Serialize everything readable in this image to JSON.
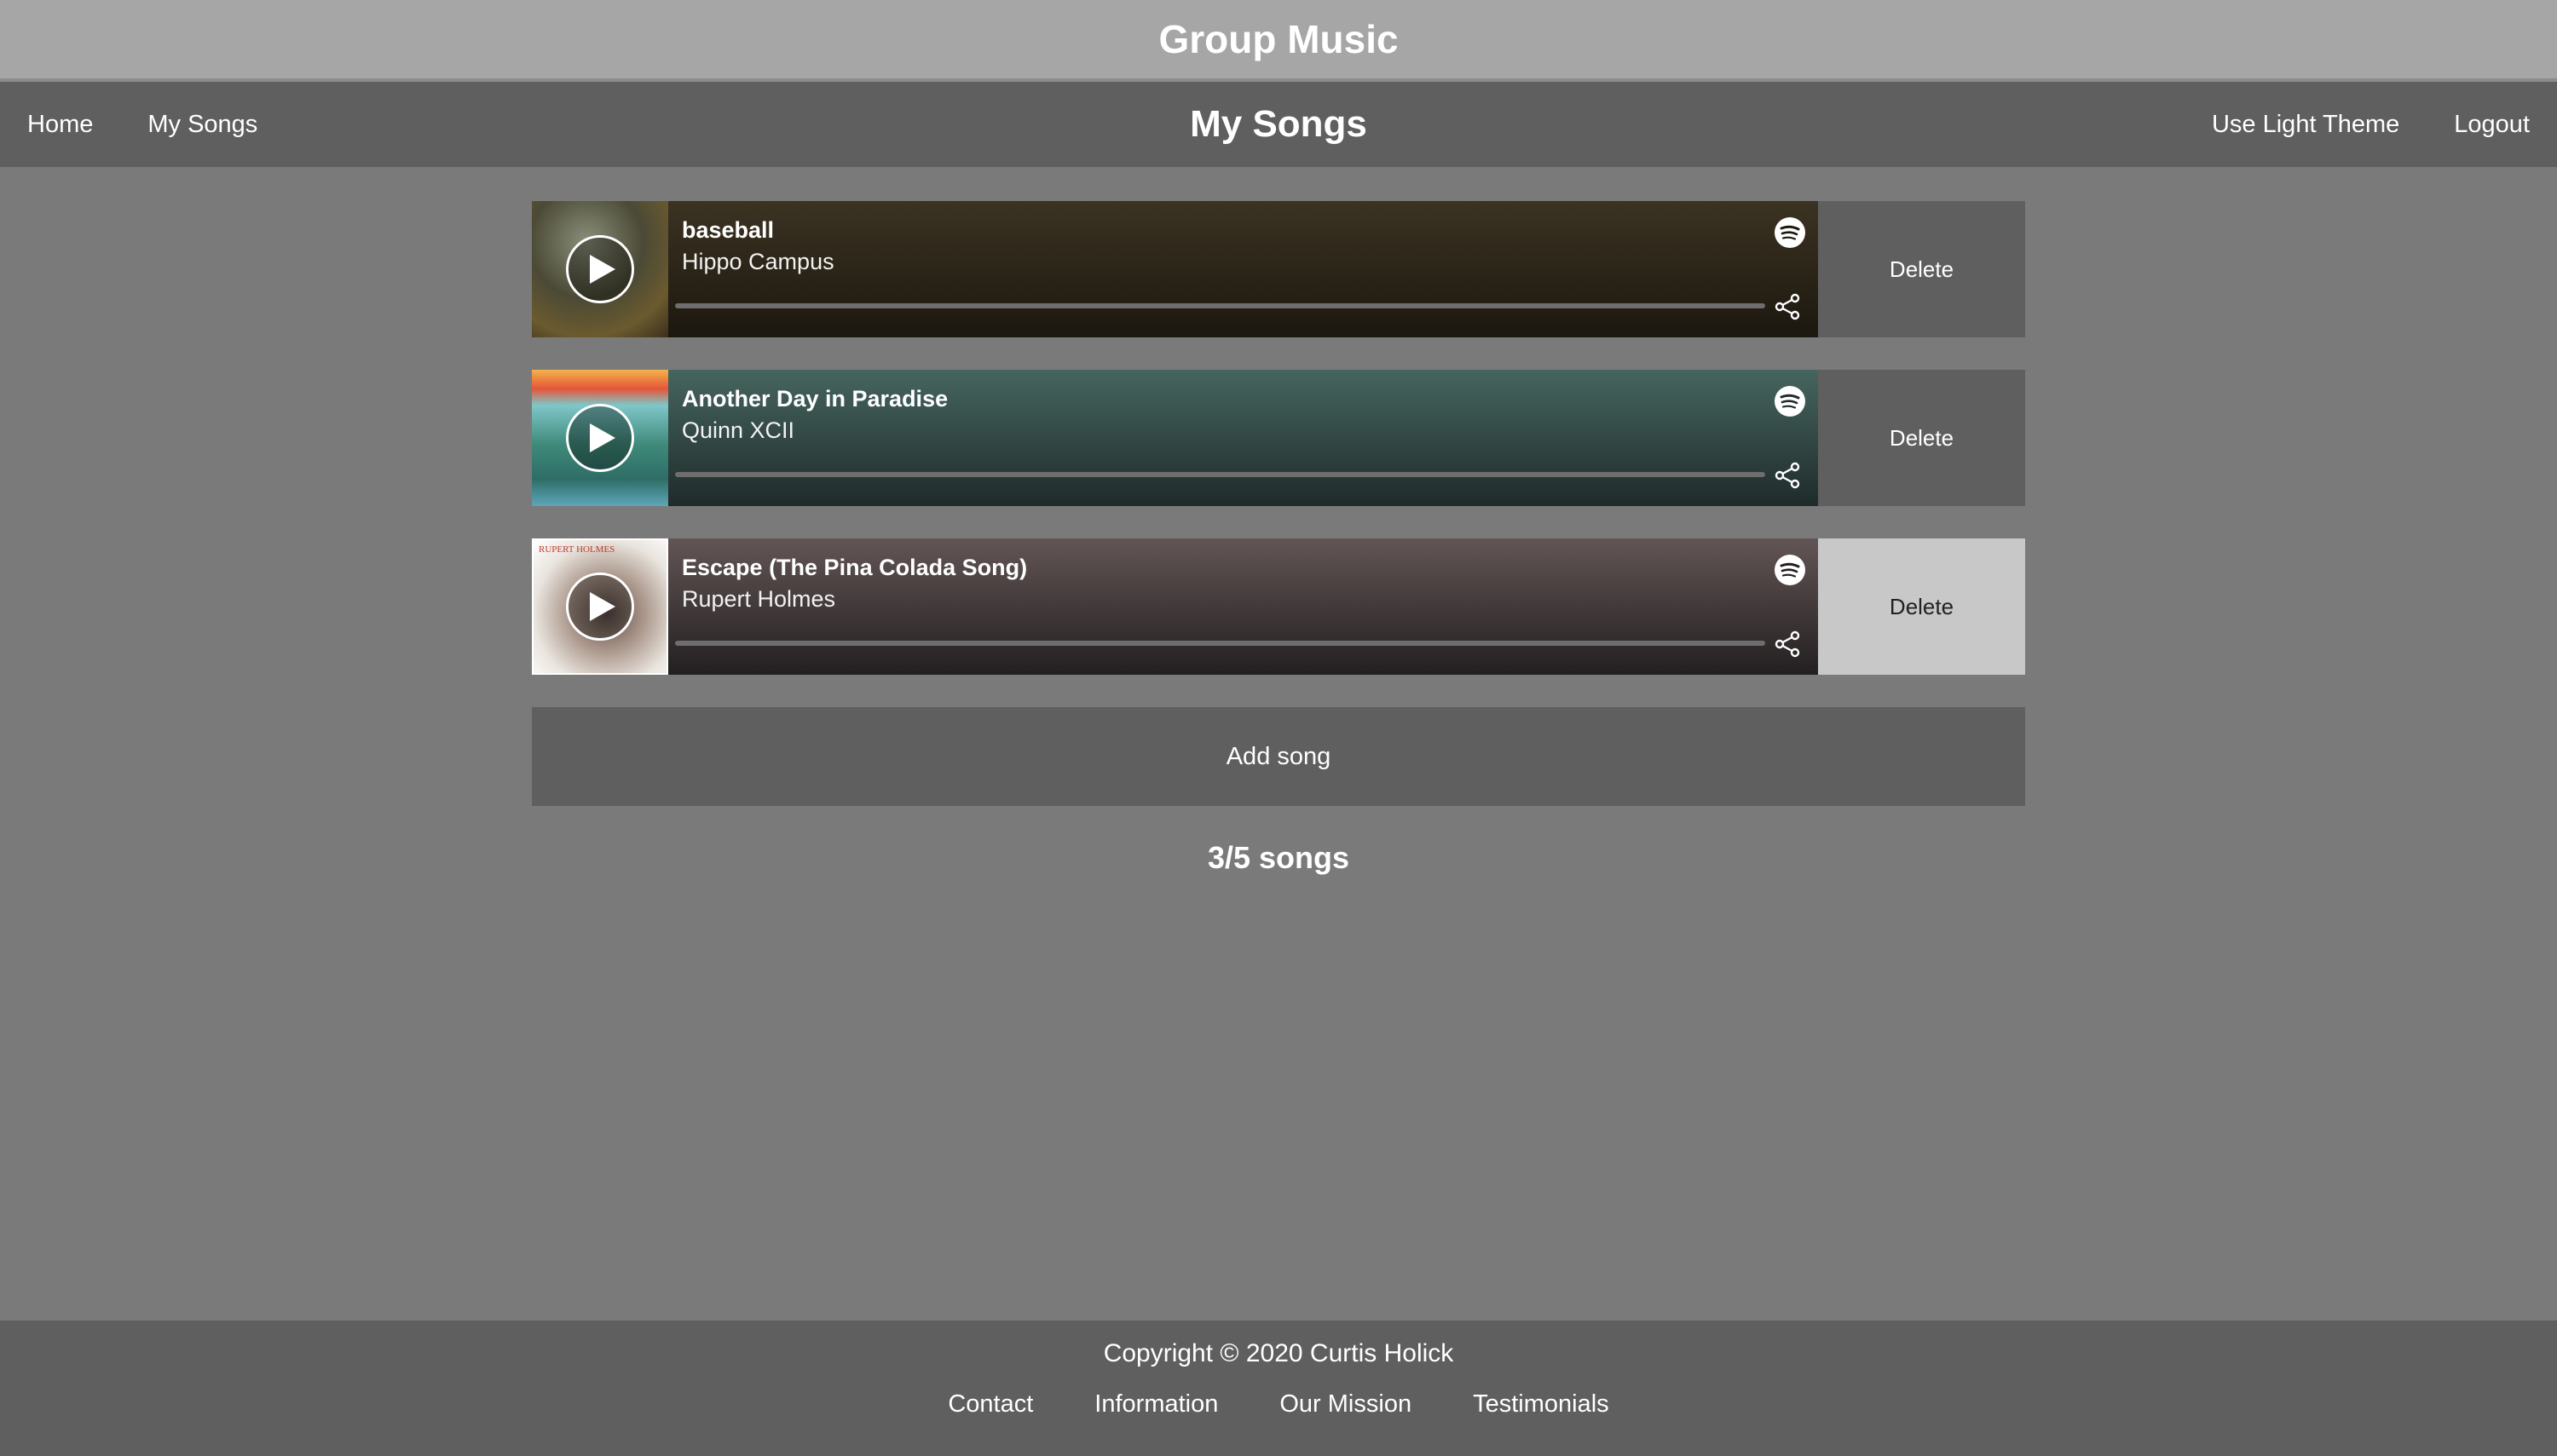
{
  "app": {
    "title": "Group Music"
  },
  "nav": {
    "left": [
      "Home",
      "My Songs"
    ],
    "page_title": "My Songs",
    "right": [
      "Use Light Theme",
      "Logout"
    ]
  },
  "songs": [
    {
      "title": "baseball",
      "artist": "Hippo Campus",
      "delete_label": "Delete",
      "progress": 0
    },
    {
      "title": "Another Day in Paradise",
      "artist": "Quinn XCII",
      "delete_label": "Delete",
      "progress": 0
    },
    {
      "title": "Escape (The Pina Colada Song)",
      "artist": "Rupert Holmes",
      "delete_label": "Delete",
      "progress": 0,
      "art_text": "RUPERT HOLMES"
    }
  ],
  "add_song_label": "Add song",
  "song_count": "3/5 songs",
  "footer": {
    "copyright": "Copyright © 2020 Curtis Holick",
    "links": [
      "Contact",
      "Information",
      "Our Mission",
      "Testimonials"
    ]
  },
  "icons": {
    "play": "play-icon",
    "spotify": "spotify-icon",
    "share": "share-icon"
  },
  "colors": {
    "header_bg": "#a6a6a6",
    "nav_bg": "#5f5f5f",
    "page_bg": "#7a7a7a",
    "delete_hover_bg": "#c8c8c8"
  }
}
